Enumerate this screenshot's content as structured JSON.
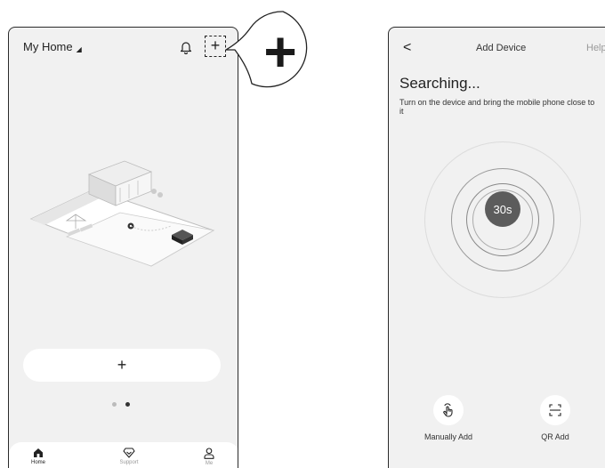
{
  "home": {
    "title": "My Home",
    "add_symbol": "+",
    "bottom_add_symbol": "+",
    "page_dots": {
      "total": 2,
      "active_index": 1
    },
    "tabs": [
      {
        "label": "Home",
        "icon": "home-icon",
        "active": true
      },
      {
        "label": "Support",
        "icon": "support-icon",
        "active": false
      },
      {
        "label": "Me",
        "icon": "user-icon",
        "active": false
      }
    ]
  },
  "callout": {
    "symbol": "+"
  },
  "add_device": {
    "back_symbol": "<",
    "title": "Add Device",
    "help": "Help",
    "heading": "Searching...",
    "instructions": "Turn on the device and bring the mobile phone close to it",
    "countdown": "30s",
    "actions": [
      {
        "label": "Manually Add",
        "icon": "hand-tap-icon"
      },
      {
        "label": "QR Add",
        "icon": "qr-scan-icon"
      }
    ]
  },
  "colors": {
    "screen_bg": "#f1f1f1",
    "card_bg": "#ffffff",
    "countdown_bg": "#5c5c5c",
    "frame": "#2a2a2a"
  }
}
